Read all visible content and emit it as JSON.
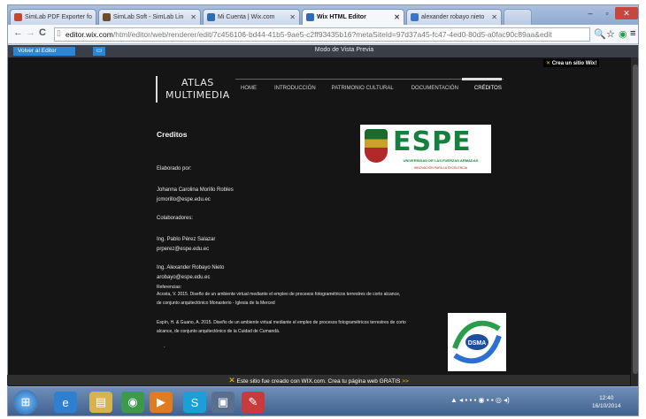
{
  "browser": {
    "tabs": [
      {
        "label": "SimLab PDF Exporter fo",
        "icon_color": "#c8452f",
        "active": false
      },
      {
        "label": "SimLab Soft - SimLab Lin",
        "icon_color": "#6e4c2b",
        "active": false
      },
      {
        "label": "Mi Cuenta | Wix.com",
        "icon_color": "#2d6db5",
        "active": false
      },
      {
        "label": "Wix HTML Editor",
        "icon_color": "#2d6db5",
        "active": true
      },
      {
        "label": "alexander robayo nieto",
        "icon_color": "#3a77c9",
        "active": false
      }
    ],
    "tab_close_icon": "✕",
    "window_controls": {
      "minimize": "–",
      "restore": "▫",
      "close": "✕"
    },
    "back_icon": "←",
    "forward_icon": "→",
    "reload_icon": "C",
    "page_icon": "▯",
    "address_host": "editor.wix.com",
    "address_path": "/html/editor/web/renderer/edit/7c456106-bd44-41b5-9ae5-c2ff93435b16?metaSiteId=97d37a45-fc47-4ed0-80d5-a0fac90c89aa&edit",
    "zoom_icon": "🔍",
    "star_icon": "☆",
    "ext_icon": "◉",
    "menu_icon": "≡"
  },
  "editor_bar": {
    "back_label": "Volver al Editor",
    "device_icon": "▭",
    "mode_label": "Modo de Vista Previa"
  },
  "site": {
    "wix_badge": {
      "star": "✕",
      "label": "Crea un sitio Wix!"
    },
    "logo_line1": "ATLAS",
    "logo_line2": "MULTIMEDIA",
    "menu": [
      "HOME",
      "INTRODUCCIÓN",
      "PATRIMONIO CULTURAL",
      "DOCUMENTACIÓN",
      "CRÉDITOS"
    ],
    "heading": "Creditos",
    "elaborado_label": "Elaborado por:",
    "author_name": "Johanna Carolina Morillo Robles",
    "author_email": "jcmorillo@espe.edu.ec",
    "colaboradores_label": "Colaboradores:",
    "collab1_name": "Ing. Pablo Pérez Salazar",
    "collab1_email": "prperez@espe.edu.ec",
    "collab2_name": "Ing. Alexander Robayo Nieto",
    "collab2_email": "arobayo@espe.edu.ec",
    "referencias_label": "Referencias:",
    "ref1_line1": "Acosta, V. 2015. Diseño de un ambiente virtual mediante el empleo de procesos fotogramétricos terrestres de corto alcance,",
    "ref1_line2": "de conjunto arquitectónico Monasterio - Iglesia de la Merced",
    "ref2_line1": "Espín, H. & Guano, A. 2015. Diseño de un ambiente virtual mediante el empleo de procesos fotogramétricos terrestres de corto",
    "ref2_line2": "alcance, de conjunto arquitectónico de la Cuidad de Cumandá.",
    "dot": ".",
    "espe_logo_text": "ESPE",
    "espe_sub": "UNIVERSIDAD DE LAS FUERZAS ARMADAS",
    "espe_sub2": "INNOVACIÓN PARA LA EXCELENCIA",
    "dsma_label": "DSMA",
    "footer_star": "✕",
    "footer_text": "Este sitio fue creado con WIX.com. Crea tu página web GRATIS",
    "footer_arrow": ">>"
  },
  "taskbar": {
    "start_icon": "⊞",
    "items": [
      "e",
      "▤",
      "◉",
      "▶",
      "S",
      "▣",
      "✎"
    ],
    "tray_icons": "▲ ◂ ▪ ▪ ▪ ◉ ▪ ▪ ◎ ◂)",
    "clock_time": "12:40",
    "clock_date": "16/10/2014"
  },
  "colors": {
    "site_bg": "#151515",
    "accent_blue": "#2a86d6",
    "espe_green": "#16813f",
    "wix_yellow": "#f2c200"
  }
}
